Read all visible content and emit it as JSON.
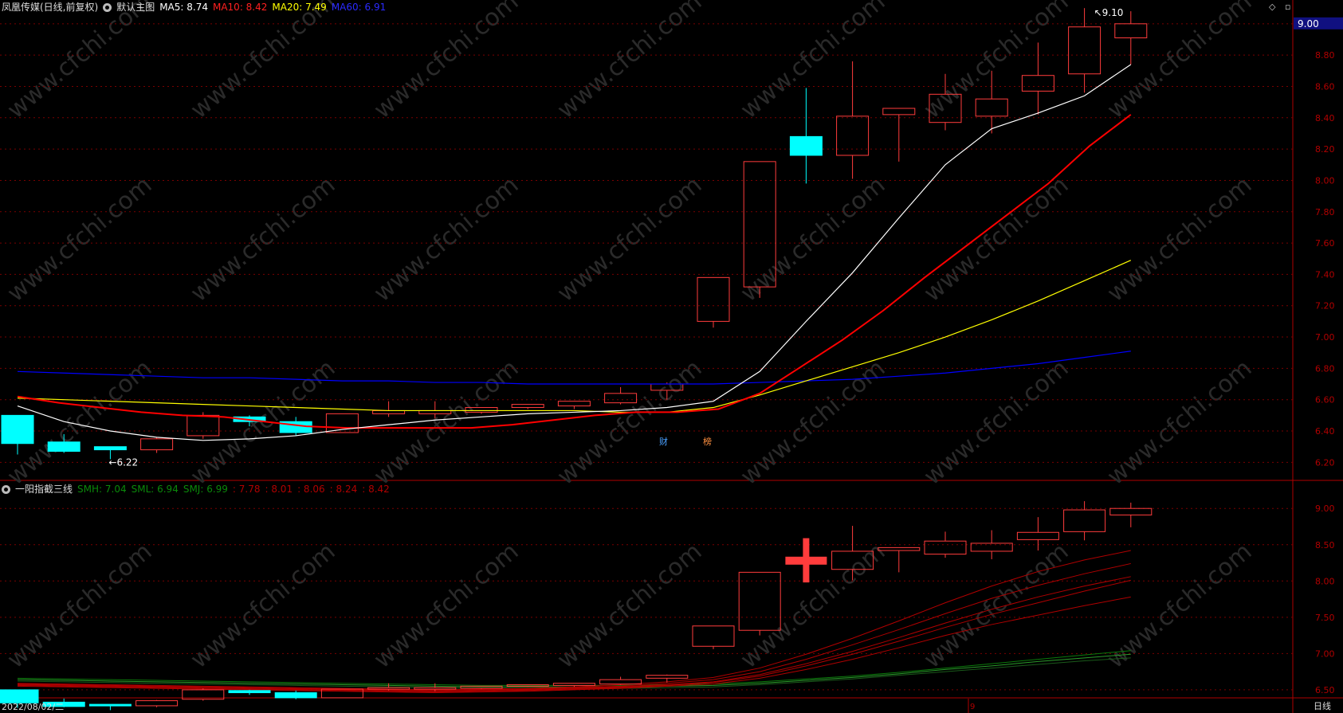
{
  "header": {
    "stock_name": "凤凰传媒(日线,前复权)",
    "template": "默认主图",
    "ma5": "MA5: 8.74",
    "ma10": "MA10: 8.42",
    "ma20": "MA20: 7.49",
    "ma60": "MA60: 6.91"
  },
  "sub_header": {
    "indicator": "一阳指截三线",
    "vals": [
      "SMH: 7.04",
      "SML: 6.94",
      "SMJ: 6.99",
      ": 7.78",
      ": 8.01",
      ": 8.06",
      ": 8.24",
      ": 8.42"
    ]
  },
  "price_axis": {
    "current_price": "9.00",
    "ticks": [
      "9.00",
      "8.80",
      "8.60",
      "8.40",
      "8.20",
      "8.00",
      "7.80",
      "7.60",
      "7.40",
      "7.20",
      "7.00",
      "6.80",
      "6.60",
      "6.40",
      "6.20"
    ],
    "sub_ticks": [
      "9.00",
      "8.50",
      "8.00",
      "7.50",
      "7.00",
      "6.50"
    ]
  },
  "annotations": {
    "high_label": "9.10",
    "low_label": "6.22",
    "marker_fin": "财",
    "marker_rank": "榜"
  },
  "footer": {
    "date": "2022/08/02/二",
    "month_mark": "9",
    "period": "日线"
  },
  "watermark": "www.cfchi.com",
  "colors": {
    "up": "#ff3c3c",
    "down": "#00ffff",
    "ma5": "#ffffff",
    "ma10": "#ff0000",
    "ma20": "#ffff00",
    "ma60": "#0000ff",
    "grid": "#7a0000"
  },
  "chart_data": {
    "type": "candlestick",
    "dates_visible": [
      "2022/08/02"
    ],
    "candles": [
      {
        "o": 6.5,
        "h": 6.5,
        "l": 6.25,
        "c": 6.32
      },
      {
        "o": 6.33,
        "h": 6.38,
        "l": 6.26,
        "c": 6.27
      },
      {
        "o": 6.3,
        "h": 6.3,
        "l": 6.22,
        "c": 6.28
      },
      {
        "o": 6.28,
        "h": 6.36,
        "l": 6.26,
        "c": 6.35
      },
      {
        "o": 6.37,
        "h": 6.52,
        "l": 6.35,
        "c": 6.5
      },
      {
        "o": 6.49,
        "h": 6.5,
        "l": 6.43,
        "c": 6.46
      },
      {
        "o": 6.46,
        "h": 6.49,
        "l": 6.37,
        "c": 6.39
      },
      {
        "o": 6.39,
        "h": 6.51,
        "l": 6.39,
        "c": 6.51
      },
      {
        "o": 6.51,
        "h": 6.59,
        "l": 6.49,
        "c": 6.53
      },
      {
        "o": 6.51,
        "h": 6.59,
        "l": 6.48,
        "c": 6.53
      },
      {
        "o": 6.52,
        "h": 6.55,
        "l": 6.51,
        "c": 6.55
      },
      {
        "o": 6.55,
        "h": 6.57,
        "l": 6.54,
        "c": 6.57
      },
      {
        "o": 6.56,
        "h": 6.59,
        "l": 6.54,
        "c": 6.59
      },
      {
        "o": 6.58,
        "h": 6.68,
        "l": 6.57,
        "c": 6.64
      },
      {
        "o": 6.66,
        "h": 6.71,
        "l": 6.6,
        "c": 6.7
      },
      {
        "o": 7.1,
        "h": 7.38,
        "l": 7.06,
        "c": 7.38
      },
      {
        "o": 7.32,
        "h": 8.12,
        "l": 7.25,
        "c": 8.12
      },
      {
        "o": 8.28,
        "h": 8.59,
        "l": 7.98,
        "c": 8.16
      },
      {
        "o": 8.16,
        "h": 8.76,
        "l": 8.01,
        "c": 8.41
      },
      {
        "o": 8.42,
        "h": 8.46,
        "l": 8.12,
        "c": 8.46
      },
      {
        "o": 8.37,
        "h": 8.68,
        "l": 8.32,
        "c": 8.55
      },
      {
        "o": 8.41,
        "h": 8.7,
        "l": 8.3,
        "c": 8.52
      },
      {
        "o": 8.57,
        "h": 8.88,
        "l": 8.42,
        "c": 8.67
      },
      {
        "o": 8.68,
        "h": 9.1,
        "l": 8.56,
        "c": 8.98
      },
      {
        "o": 8.91,
        "h": 9.08,
        "l": 8.74,
        "c": 9.0
      }
    ],
    "ma5": [
      6.56,
      6.46,
      6.4,
      6.36,
      6.34,
      6.35,
      6.37,
      6.41,
      6.44,
      6.47,
      6.49,
      6.51,
      6.52,
      6.53,
      6.55,
      6.59,
      6.78,
      7.1,
      7.41,
      7.76,
      8.1,
      8.33,
      8.43,
      8.54,
      8.74
    ],
    "ma10": [
      6.62,
      6.58,
      6.55,
      6.52,
      6.5,
      6.49,
      6.46,
      6.43,
      6.42,
      6.42,
      6.42,
      6.42,
      6.44,
      6.47,
      6.5,
      6.52,
      6.52,
      6.54,
      6.64,
      6.81,
      6.98,
      7.17,
      7.38,
      7.58,
      7.78,
      7.98,
      8.22,
      8.42
    ],
    "ma20": [
      6.61,
      6.6,
      6.59,
      6.58,
      6.57,
      6.56,
      6.55,
      6.54,
      6.53,
      6.53,
      6.53,
      6.53,
      6.53,
      6.52,
      6.52,
      6.55,
      6.63,
      6.72,
      6.81,
      6.9,
      7.0,
      7.11,
      7.23,
      7.36,
      7.49
    ],
    "ma60": [
      6.78,
      6.77,
      6.76,
      6.75,
      6.74,
      6.74,
      6.73,
      6.72,
      6.72,
      6.71,
      6.71,
      6.7,
      6.7,
      6.7,
      6.7,
      6.7,
      6.71,
      6.72,
      6.73,
      6.75,
      6.77,
      6.8,
      6.83,
      6.87,
      6.91
    ],
    "price_range": [
      6.1,
      9.05
    ],
    "sub_range": [
      6.4,
      9.2
    ],
    "sub_lines": {
      "SMH": [
        6.66,
        6.65,
        6.64,
        6.63,
        6.62,
        6.61,
        6.6,
        6.59,
        6.58,
        6.57,
        6.56,
        6.56,
        6.56,
        6.56,
        6.57,
        6.58,
        6.61,
        6.65,
        6.69,
        6.74,
        6.8,
        6.86,
        6.92,
        6.98,
        7.04
      ],
      "SML": [
        6.62,
        6.61,
        6.6,
        6.59,
        6.58,
        6.57,
        6.56,
        6.55,
        6.54,
        6.53,
        6.52,
        6.52,
        6.52,
        6.52,
        6.53,
        6.54,
        6.57,
        6.61,
        6.65,
        6.7,
        6.75,
        6.8,
        6.85,
        6.9,
        6.94
      ],
      "SMJ": [
        6.64,
        6.63,
        6.62,
        6.61,
        6.6,
        6.59,
        6.58,
        6.57,
        6.56,
        6.55,
        6.54,
        6.54,
        6.54,
        6.54,
        6.55,
        6.56,
        6.59,
        6.63,
        6.67,
        6.72,
        6.78,
        6.83,
        6.89,
        6.94,
        6.99
      ],
      "L1": [
        6.55,
        6.54,
        6.53,
        6.52,
        6.51,
        6.5,
        6.49,
        6.48,
        6.47,
        6.46,
        6.47,
        6.48,
        6.5,
        6.52,
        6.55,
        6.58,
        6.66,
        6.78,
        6.92,
        7.08,
        7.25,
        7.4,
        7.53,
        7.66,
        7.78
      ],
      "L2": [
        6.56,
        6.55,
        6.54,
        6.53,
        6.52,
        6.51,
        6.5,
        6.49,
        6.48,
        6.47,
        6.48,
        6.49,
        6.51,
        6.53,
        6.56,
        6.6,
        6.69,
        6.83,
        6.99,
        7.17,
        7.36,
        7.54,
        7.7,
        7.86,
        8.01
      ],
      "L3": [
        6.57,
        6.56,
        6.55,
        6.54,
        6.53,
        6.52,
        6.51,
        6.5,
        6.49,
        6.48,
        6.49,
        6.5,
        6.52,
        6.54,
        6.57,
        6.61,
        6.71,
        6.86,
        7.03,
        7.22,
        7.42,
        7.61,
        7.78,
        7.93,
        8.06
      ],
      "L4": [
        6.58,
        6.57,
        6.56,
        6.55,
        6.54,
        6.53,
        6.52,
        6.51,
        6.5,
        6.49,
        6.5,
        6.51,
        6.53,
        6.55,
        6.59,
        6.64,
        6.75,
        6.92,
        7.12,
        7.33,
        7.55,
        7.76,
        7.94,
        8.1,
        8.24
      ],
      "L5": [
        6.59,
        6.58,
        6.57,
        6.56,
        6.55,
        6.54,
        6.53,
        6.52,
        6.51,
        6.5,
        6.51,
        6.52,
        6.54,
        6.57,
        6.61,
        6.67,
        6.8,
        6.99,
        7.21,
        7.45,
        7.7,
        7.93,
        8.13,
        8.29,
        8.42
      ]
    }
  }
}
